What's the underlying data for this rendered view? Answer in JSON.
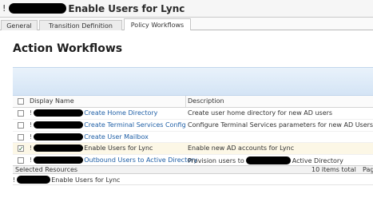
{
  "window": {
    "title_prefix": "!",
    "title": "Enable Users for Lync"
  },
  "tabs": [
    {
      "label": "General",
      "active": false
    },
    {
      "label": "Transition Definition",
      "active": false
    },
    {
      "label": "Policy Workflows",
      "active": true
    }
  ],
  "page": {
    "heading": "Action Workflows"
  },
  "grid": {
    "columns": [
      "Display Name",
      "Description"
    ],
    "rows": [
      {
        "prefix": "!",
        "name": "Create Home Directory",
        "description_before": "Create user home directory for new AD users",
        "description_after": "",
        "checked": false,
        "selected": false
      },
      {
        "prefix": "!",
        "name": "Create Terminal Services Config",
        "description_before": "Configure Terminal Services parameters for new AD Users",
        "description_after": "",
        "checked": false,
        "selected": false
      },
      {
        "prefix": "!",
        "name": "Create User Mailbox",
        "description_before": "",
        "description_after": "",
        "checked": false,
        "selected": false
      },
      {
        "prefix": "!",
        "name": "Enable Users for Lync",
        "description_before": "Enable new AD accounts for Lync",
        "description_after": "",
        "checked": true,
        "selected": true
      },
      {
        "prefix": "!",
        "name": "Outbound Users to Active Directory",
        "description_before": "Provision users to",
        "description_after": "Active Directory",
        "checked": false,
        "selected": false
      }
    ]
  },
  "selected_resources": {
    "label": "Selected Resources",
    "count": "10 items total",
    "page_label": "Pag",
    "item_prefix": "!",
    "item_name": "Enable Users for Lync"
  },
  "colors": {
    "link": "#1f5fa6",
    "selected_row": "#fcf7e6",
    "band_top": "#e9f2fb",
    "band_bottom": "#d4e4f5"
  }
}
